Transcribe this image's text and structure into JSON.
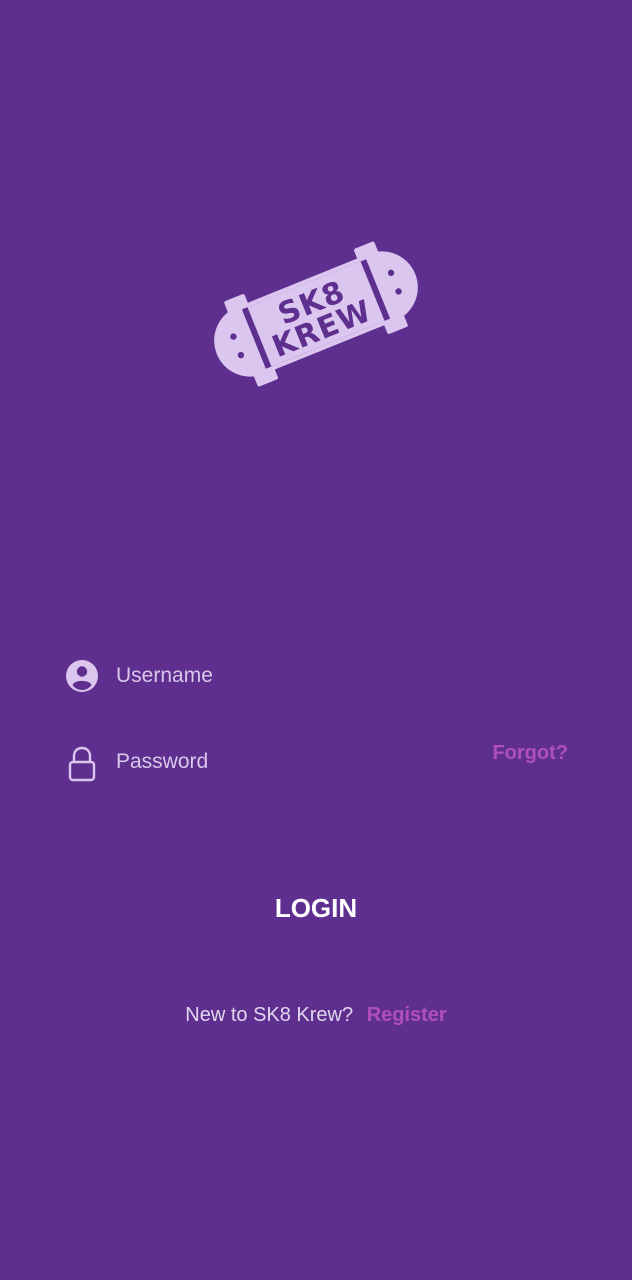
{
  "logo": {
    "text_line1": "SK8",
    "text_line2": "KREW",
    "icon": "skateboard-logo",
    "color": "#dbc6ef"
  },
  "form": {
    "username": {
      "placeholder": "Username",
      "value": "",
      "icon": "account-circle-icon"
    },
    "password": {
      "placeholder": "Password",
      "value": "",
      "icon": "lock-icon",
      "forgot_label": "Forgot?"
    }
  },
  "login_label": "LOGIN",
  "register": {
    "prompt": "New to SK8 Krew?",
    "link_label": "Register"
  },
  "colors": {
    "background": "#5f2f8f",
    "accent": "#b04ec0",
    "text": "#ffffff",
    "muted": "#d8c8ea"
  }
}
